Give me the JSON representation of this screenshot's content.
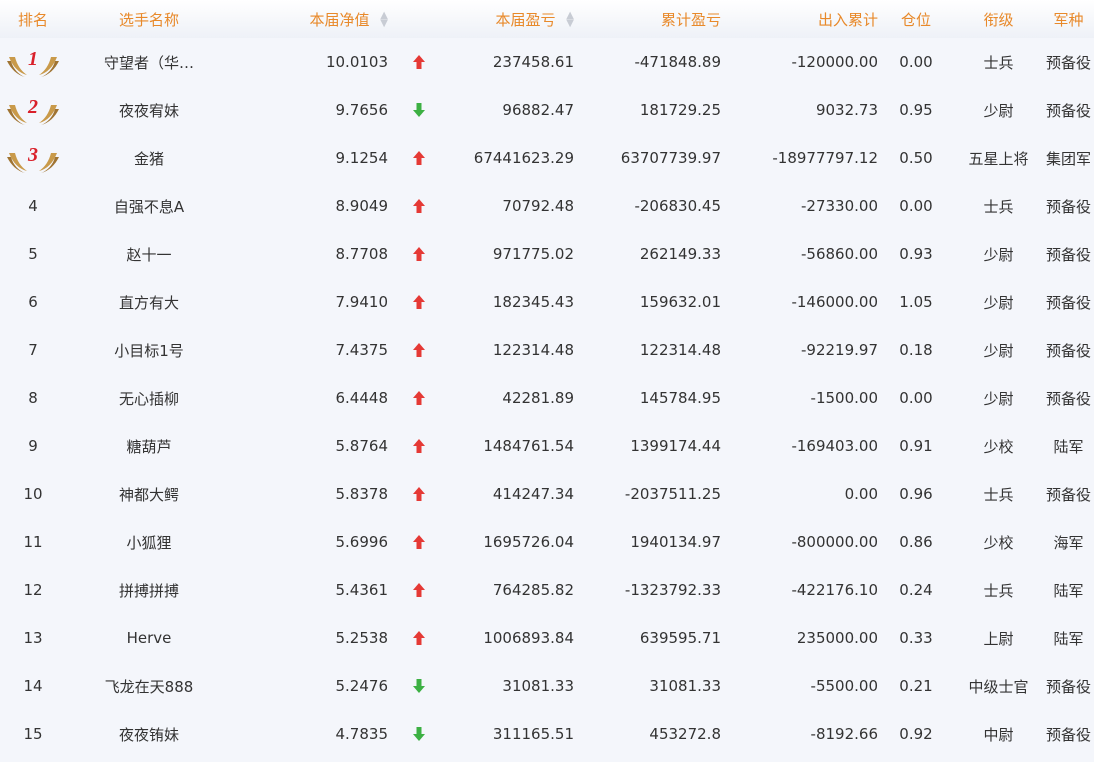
{
  "colors": {
    "header_text": "#e8892a",
    "arrow_up": "#e53935",
    "arrow_down": "#3cb043",
    "medal_gold": "#c99a4a",
    "medal_number": "#d9202a"
  },
  "headers": {
    "rank": "排名",
    "name": "选手名称",
    "netval": "本届净值",
    "pnl": "本届盈亏",
    "cum_pnl": "累计盈亏",
    "inout": "出入累计",
    "position": "仓位",
    "title": "衔级",
    "army": "军种"
  },
  "rows": [
    {
      "rank": "1",
      "medal": true,
      "name": "守望者（华…",
      "netval": "10.0103",
      "trend": "up",
      "pnl": "237458.61",
      "cum": "-471848.89",
      "inout": "-120000.00",
      "pos": "0.00",
      "title": "士兵",
      "army": "预备役"
    },
    {
      "rank": "2",
      "medal": true,
      "name": "夜夜宥妹",
      "netval": "9.7656",
      "trend": "down",
      "pnl": "96882.47",
      "cum": "181729.25",
      "inout": "9032.73",
      "pos": "0.95",
      "title": "少尉",
      "army": "预备役"
    },
    {
      "rank": "3",
      "medal": true,
      "name": "金猪",
      "netval": "9.1254",
      "trend": "up",
      "pnl": "67441623.29",
      "cum": "63707739.97",
      "inout": "-18977797.12",
      "pos": "0.50",
      "title": "五星上将",
      "army": "集团军"
    },
    {
      "rank": "4",
      "medal": false,
      "name": "自强不息A",
      "netval": "8.9049",
      "trend": "up",
      "pnl": "70792.48",
      "cum": "-206830.45",
      "inout": "-27330.00",
      "pos": "0.00",
      "title": "士兵",
      "army": "预备役"
    },
    {
      "rank": "5",
      "medal": false,
      "name": "赵十一",
      "netval": "8.7708",
      "trend": "up",
      "pnl": "971775.02",
      "cum": "262149.33",
      "inout": "-56860.00",
      "pos": "0.93",
      "title": "少尉",
      "army": "预备役"
    },
    {
      "rank": "6",
      "medal": false,
      "name": "直方有大",
      "netval": "7.9410",
      "trend": "up",
      "pnl": "182345.43",
      "cum": "159632.01",
      "inout": "-146000.00",
      "pos": "1.05",
      "title": "少尉",
      "army": "预备役"
    },
    {
      "rank": "7",
      "medal": false,
      "name": "小目标1号",
      "netval": "7.4375",
      "trend": "up",
      "pnl": "122314.48",
      "cum": "122314.48",
      "inout": "-92219.97",
      "pos": "0.18",
      "title": "少尉",
      "army": "预备役"
    },
    {
      "rank": "8",
      "medal": false,
      "name": "无心插柳",
      "netval": "6.4448",
      "trend": "up",
      "pnl": "42281.89",
      "cum": "145784.95",
      "inout": "-1500.00",
      "pos": "0.00",
      "title": "少尉",
      "army": "预备役"
    },
    {
      "rank": "9",
      "medal": false,
      "name": "糖葫芦",
      "netval": "5.8764",
      "trend": "up",
      "pnl": "1484761.54",
      "cum": "1399174.44",
      "inout": "-169403.00",
      "pos": "0.91",
      "title": "少校",
      "army": "陆军"
    },
    {
      "rank": "10",
      "medal": false,
      "name": "神都大鳄",
      "netval": "5.8378",
      "trend": "up",
      "pnl": "414247.34",
      "cum": "-2037511.25",
      "inout": "0.00",
      "pos": "0.96",
      "title": "士兵",
      "army": "预备役"
    },
    {
      "rank": "11",
      "medal": false,
      "name": "小狐狸",
      "netval": "5.6996",
      "trend": "up",
      "pnl": "1695726.04",
      "cum": "1940134.97",
      "inout": "-800000.00",
      "pos": "0.86",
      "title": "少校",
      "army": "海军"
    },
    {
      "rank": "12",
      "medal": false,
      "name": "拼搏拼搏",
      "netval": "5.4361",
      "trend": "up",
      "pnl": "764285.82",
      "cum": "-1323792.33",
      "inout": "-422176.10",
      "pos": "0.24",
      "title": "士兵",
      "army": "陆军"
    },
    {
      "rank": "13",
      "medal": false,
      "name": "Herve",
      "netval": "5.2538",
      "trend": "up",
      "pnl": "1006893.84",
      "cum": "639595.71",
      "inout": "235000.00",
      "pos": "0.33",
      "title": "上尉",
      "army": "陆军"
    },
    {
      "rank": "14",
      "medal": false,
      "name": "飞龙在天888",
      "netval": "5.2476",
      "trend": "down",
      "pnl": "31081.33",
      "cum": "31081.33",
      "inout": "-5500.00",
      "pos": "0.21",
      "title": "中级士官",
      "army": "预备役"
    },
    {
      "rank": "15",
      "medal": false,
      "name": "夜夜铕妹",
      "netval": "4.7835",
      "trend": "down",
      "pnl": "311165.51",
      "cum": "453272.8",
      "inout": "-8192.66",
      "pos": "0.92",
      "title": "中尉",
      "army": "预备役"
    }
  ]
}
